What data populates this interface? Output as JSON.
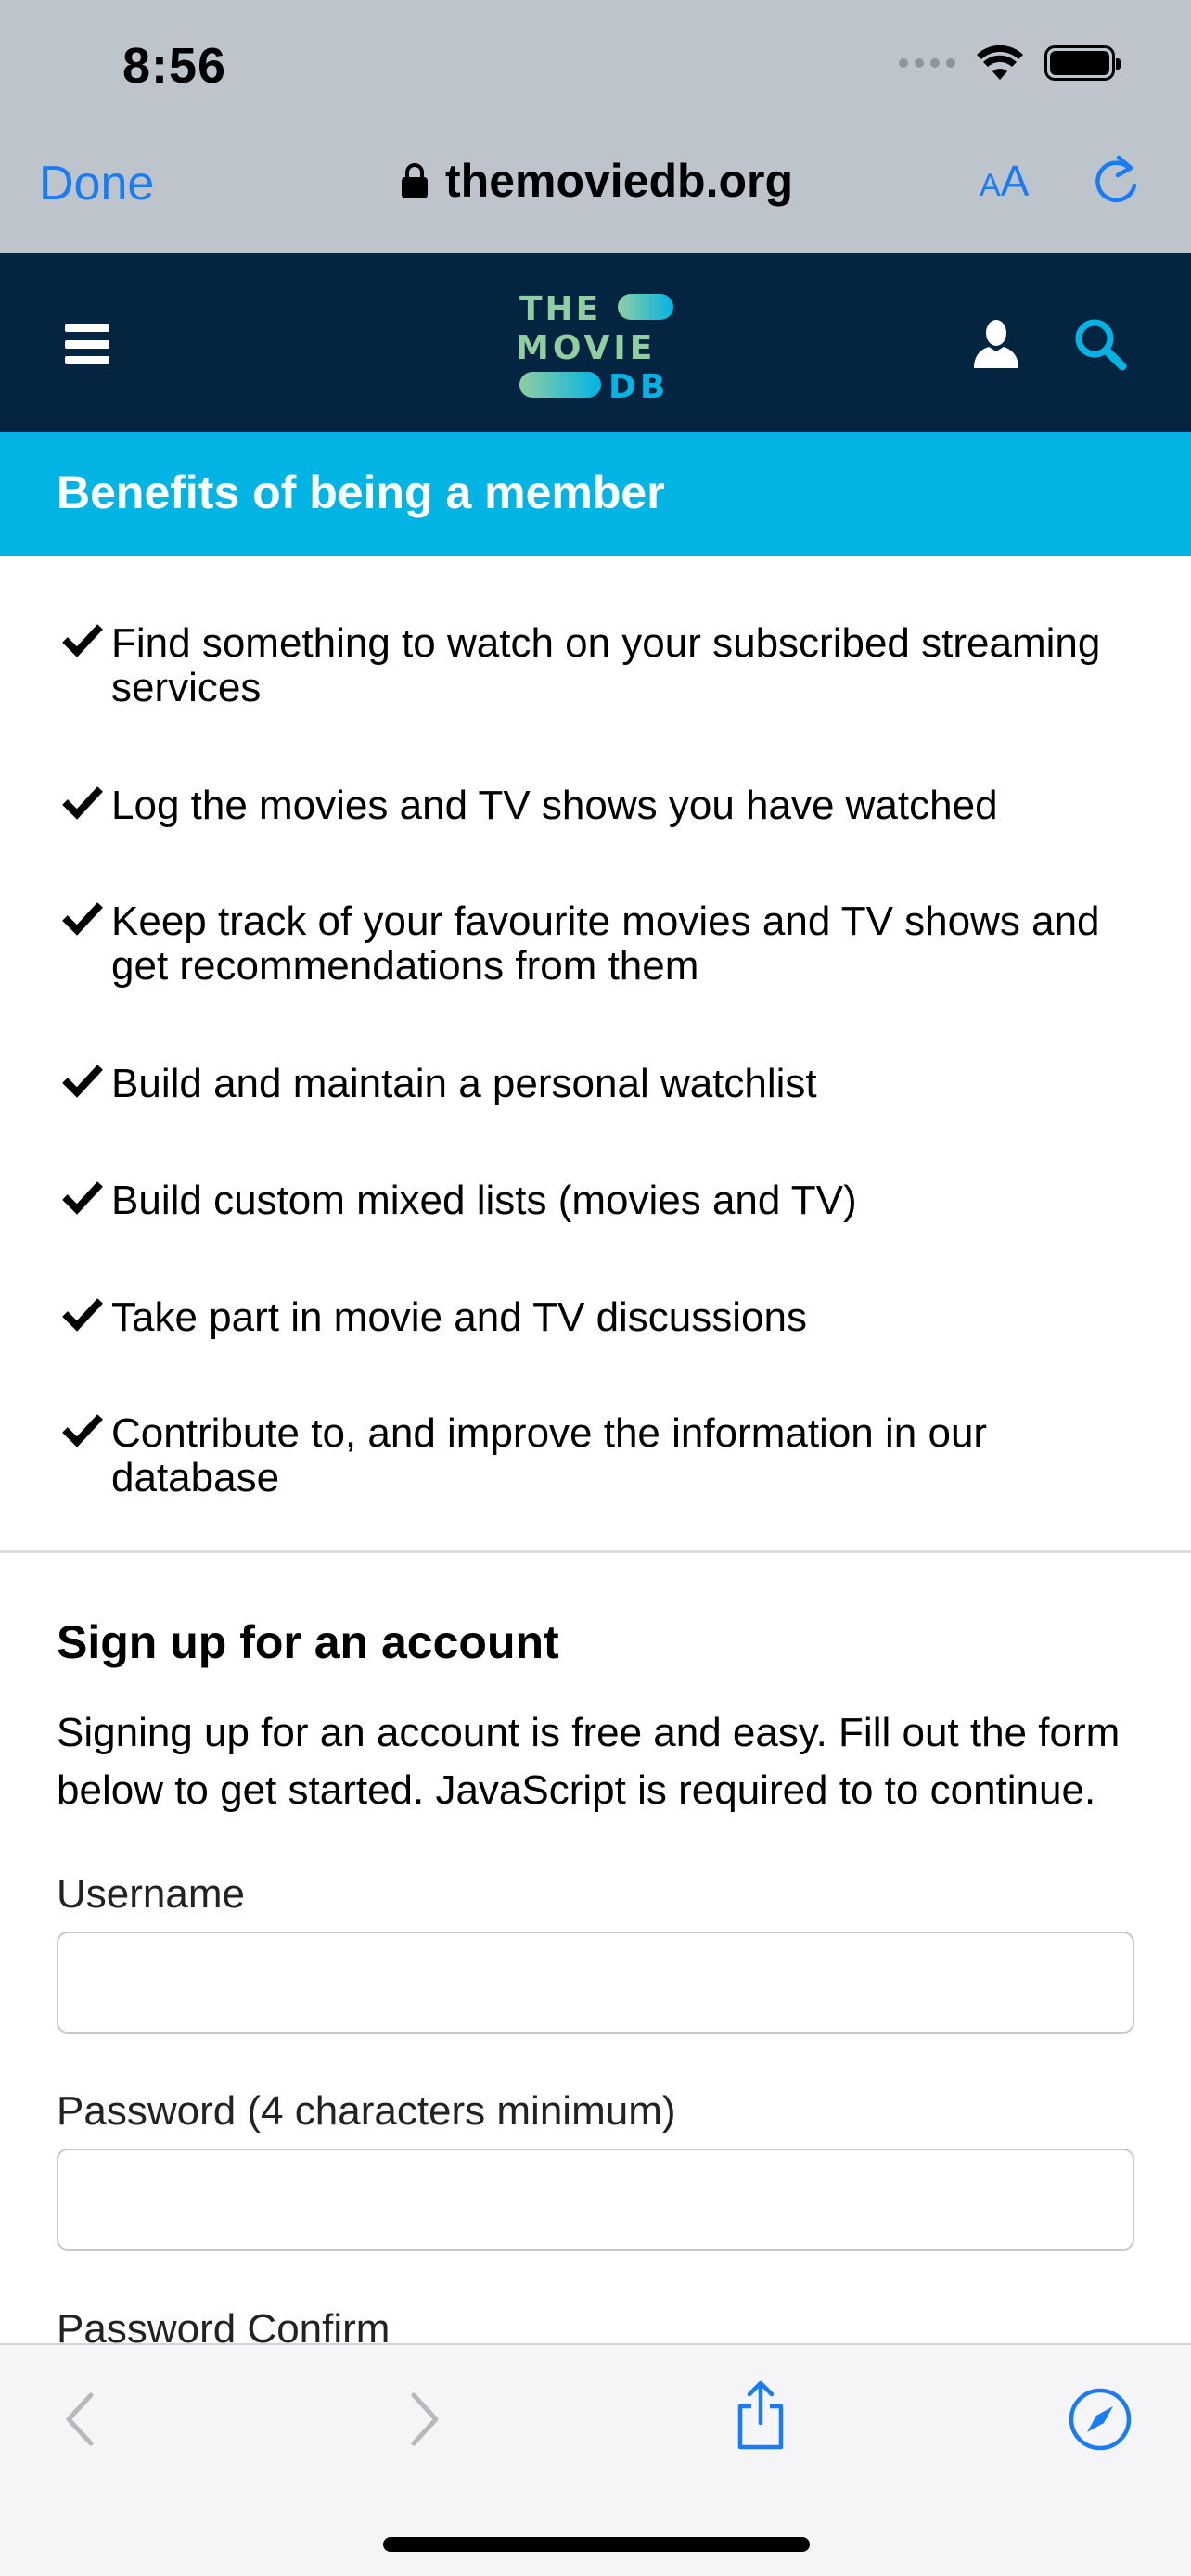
{
  "status_bar": {
    "time": "8:56"
  },
  "browser": {
    "done_label": "Done",
    "url": "themoviedb.org",
    "aa_small": "A",
    "aa_large": "A",
    "accent_color": "#1a7cf5"
  },
  "nav": {
    "background": "#032541",
    "logo_lines": [
      "THE",
      "MOVIE",
      "DB"
    ]
  },
  "benefits": {
    "title": "Benefits of being a member",
    "banner_color": "#01b4e4",
    "items": [
      "Find something to watch on your subscribed streaming services",
      "Log the movies and TV shows you have watched",
      "Keep track of your favourite movies and TV shows and get recommendations from them",
      "Build and maintain a personal watchlist",
      "Build custom mixed lists (movies and TV)",
      "Take part in movie and TV discussions",
      "Contribute to, and improve the information in our database"
    ]
  },
  "signup": {
    "title": "Sign up for an account",
    "description": "Signing up for an account is free and easy. Fill out the form below to get started. JavaScript is required to to continue.",
    "fields": [
      {
        "label": "Username",
        "value": ""
      },
      {
        "label": "Password (4 characters minimum)",
        "value": ""
      },
      {
        "label": "Password Confirm",
        "value": ""
      }
    ]
  },
  "toolbar": {
    "icons": [
      "back-icon",
      "forward-icon",
      "share-icon",
      "compass-icon"
    ]
  }
}
